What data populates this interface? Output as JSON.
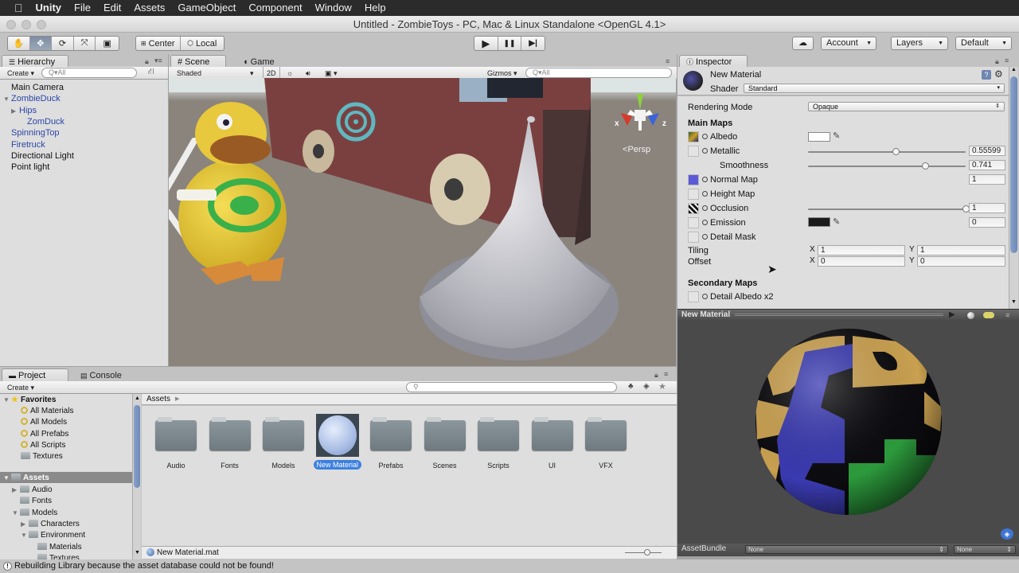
{
  "menubar": {
    "apple_icon": "apple-icon",
    "app": "Unity",
    "items": [
      "File",
      "Edit",
      "Assets",
      "GameObject",
      "Component",
      "Window",
      "Help"
    ]
  },
  "window": {
    "title": "Untitled - ZombieToys - PC, Mac & Linux Standalone <OpenGL 4.1>"
  },
  "toolbar": {
    "tools": [
      "hand-tool",
      "move-tool",
      "rotate-tool",
      "scale-tool",
      "rect-tool"
    ],
    "pivot_label": "Center",
    "space_label": "Local",
    "play_icon": "▶",
    "pause_icon": "❚❚",
    "step_icon": "▶|",
    "cloud_icon": "cloud-icon",
    "account_label": "Account",
    "layers_label": "Layers",
    "layout_label": "Default"
  },
  "hierarchy": {
    "tab": "Hierarchy",
    "create_label": "Create",
    "search_placeholder": "Q▾All",
    "items": [
      {
        "label": "Main Camera",
        "indent": 0,
        "prefab": false,
        "arrow": ""
      },
      {
        "label": "ZombieDuck",
        "indent": 0,
        "prefab": true,
        "arrow": "▼"
      },
      {
        "label": "Hips",
        "indent": 1,
        "prefab": true,
        "arrow": "▶"
      },
      {
        "label": "ZomDuck",
        "indent": 2,
        "prefab": true,
        "arrow": ""
      },
      {
        "label": "SpinningTop",
        "indent": 0,
        "prefab": true,
        "arrow": ""
      },
      {
        "label": "Firetruck",
        "indent": 0,
        "prefab": true,
        "arrow": ""
      },
      {
        "label": "Directional Light",
        "indent": 0,
        "prefab": false,
        "arrow": ""
      },
      {
        "label": "Point light",
        "indent": 0,
        "prefab": false,
        "arrow": ""
      }
    ]
  },
  "scene": {
    "tab_scene": "Scene",
    "tab_game": "Game",
    "shading_mode": "Shaded",
    "mode_2d": "2D",
    "gizmos_label": "Gizmos",
    "search_placeholder": "Q▾All",
    "projection_label": "Persp",
    "axis_x": "x",
    "axis_z": "z"
  },
  "inspector": {
    "tab": "Inspector",
    "material_name": "New Material",
    "shader_label": "Shader",
    "shader_value": "Standard",
    "rendering_mode_label": "Rendering Mode",
    "rendering_mode_value": "Opaque",
    "main_maps_heading": "Main Maps",
    "albedo_label": "Albedo",
    "albedo_color": "#ffffff",
    "metallic_label": "Metallic",
    "metallic_value": "0.55599",
    "metallic_fraction": 0.556,
    "smoothness_label": "Smoothness",
    "smoothness_value": "0.741",
    "smoothness_fraction": 0.741,
    "normal_map_label": "Normal Map",
    "normal_map_value": "1",
    "height_map_label": "Height Map",
    "occlusion_label": "Occlusion",
    "occlusion_value": "1",
    "occlusion_fraction": 1.0,
    "emission_label": "Emission",
    "emission_color": "#1a1a1a",
    "emission_value": "0",
    "detail_mask_label": "Detail Mask",
    "tiling_label": "Tiling",
    "tiling_x": "1",
    "tiling_y": "1",
    "offset_label": "Offset",
    "offset_x": "0",
    "offset_y": "0",
    "x_label": "X",
    "y_label": "Y",
    "secondary_maps_heading": "Secondary Maps",
    "detail_albedo_label": "Detail Albedo x2"
  },
  "preview": {
    "title": "New Material",
    "asset_bundle_label": "AssetBundle",
    "bundle_name": "None",
    "bundle_variant": "None"
  },
  "project": {
    "tab_project": "Project",
    "tab_console": "Console",
    "create_label": "Create",
    "favorites_label": "Favorites",
    "favorites": [
      "All Materials",
      "All Models",
      "All Prefabs",
      "All Scripts"
    ],
    "textures_label": "Textures",
    "assets_label": "Assets",
    "tree": [
      {
        "label": "Audio",
        "indent": 1,
        "arrow": "▶"
      },
      {
        "label": "Fonts",
        "indent": 1,
        "arrow": ""
      },
      {
        "label": "Models",
        "indent": 1,
        "arrow": "▼"
      },
      {
        "label": "Characters",
        "indent": 2,
        "arrow": "▶"
      },
      {
        "label": "Environment",
        "indent": 2,
        "arrow": "▼"
      },
      {
        "label": "Materials",
        "indent": 3,
        "arrow": ""
      },
      {
        "label": "Textures",
        "indent": 3,
        "arrow": ""
      }
    ],
    "breadcrumb": "Assets",
    "assets": [
      {
        "label": "Audio",
        "type": "folder"
      },
      {
        "label": "Fonts",
        "type": "folder"
      },
      {
        "label": "Models",
        "type": "folder"
      },
      {
        "label": "New Material",
        "type": "material",
        "selected": true
      },
      {
        "label": "Prefabs",
        "type": "folder"
      },
      {
        "label": "Scenes",
        "type": "folder"
      },
      {
        "label": "Scripts",
        "type": "folder"
      },
      {
        "label": "UI",
        "type": "folder"
      },
      {
        "label": "VFX",
        "type": "folder"
      }
    ],
    "selected_file": "New Material.mat"
  },
  "status": {
    "message": "Rebuilding Library because the asset database could not be found!"
  },
  "colors": {
    "selection_blue": "#3d80df",
    "prefab_blue": "#2b46a8",
    "preview_bg": "#4a4a4a"
  }
}
